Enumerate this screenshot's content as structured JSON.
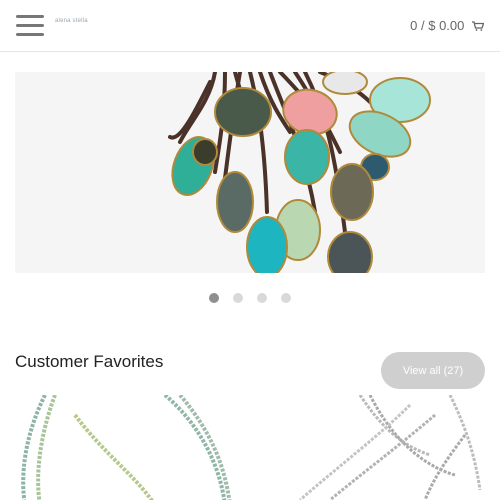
{
  "header": {
    "menu_icon": "hamburger-menu-icon",
    "logo_text": "alena  stella",
    "cart_text": "0 / $ 0.00",
    "cart_icon": "shopping-cart-icon"
  },
  "carousel": {
    "slide_count": 4,
    "active_index": 0
  },
  "favorites": {
    "title": "Customer Favorites",
    "view_all_label": "View all (27)"
  },
  "colors": {
    "text_dark": "#222222",
    "text_gray": "#666666",
    "button_gray": "#cfcfcf",
    "dot_active": "#8f8f8f",
    "dot_inactive": "#d9d9d9"
  }
}
